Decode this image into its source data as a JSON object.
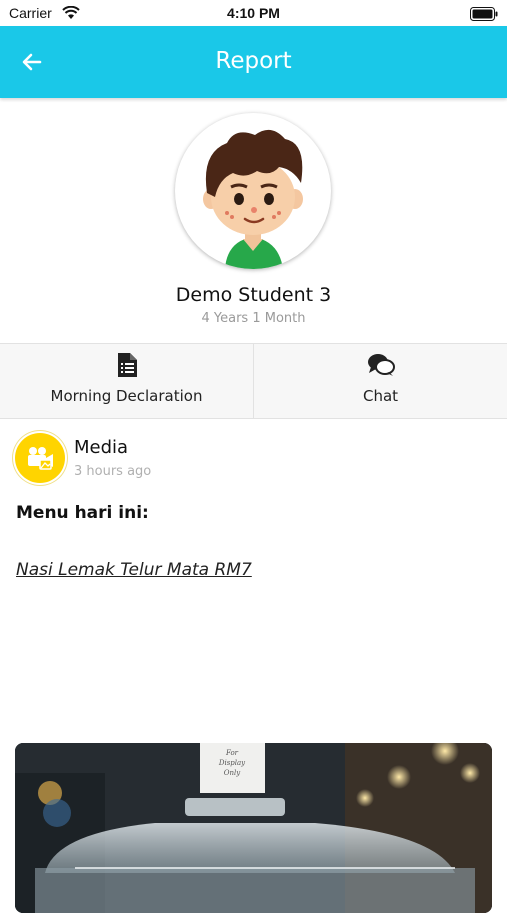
{
  "status_bar": {
    "carrier": "Carrier",
    "time": "4:10 PM",
    "icons": [
      "wifi-icon",
      "battery-icon"
    ]
  },
  "header": {
    "title": "Report",
    "back_icon": "arrow-left-icon",
    "background": "#1ac8e8"
  },
  "student": {
    "name": "Demo Student 3",
    "age": "4 Years 1 Month"
  },
  "actions": [
    {
      "label": "Morning Declaration",
      "icon": "document-list-icon"
    },
    {
      "label": "Chat",
      "icon": "chat-bubbles-icon"
    }
  ],
  "post": {
    "type": "Media",
    "icon": "media-camera-icon",
    "time": "3 hours ago",
    "heading": "Menu hari ini:",
    "link_text": "Nasi Lemak Telur Mata RM7"
  },
  "colors": {
    "accent": "#1ac8e8",
    "media_badge": "#ffd400"
  }
}
